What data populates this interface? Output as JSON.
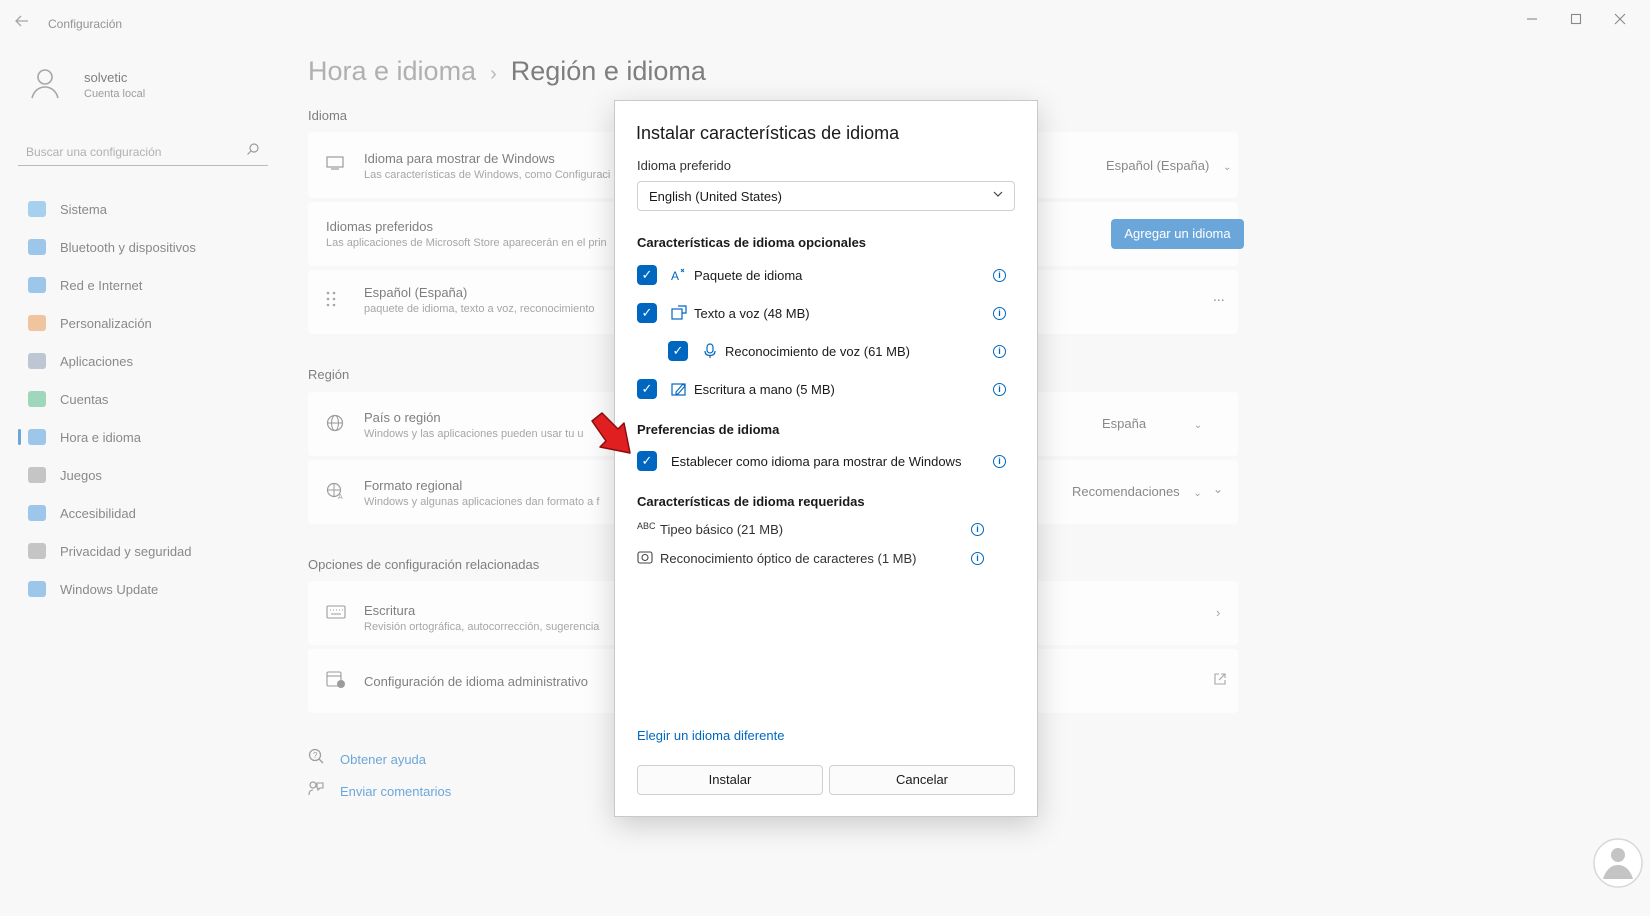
{
  "app": {
    "title": "Configuración",
    "back_icon": "back-arrow-icon",
    "window_controls": [
      "minimize-icon",
      "maximize-icon",
      "close-icon"
    ]
  },
  "user": {
    "name": "solvetic",
    "account_type": "Cuenta local"
  },
  "search": {
    "placeholder": "Buscar una configuración"
  },
  "sidebar": {
    "items": [
      {
        "label": "Sistema",
        "icon": "system-icon",
        "color": "#4aa3df"
      },
      {
        "label": "Bluetooth y dispositivos",
        "icon": "bluetooth-icon",
        "color": "#3b8fd6"
      },
      {
        "label": "Red e Internet",
        "icon": "wifi-icon",
        "color": "#3b8fd6"
      },
      {
        "label": "Personalización",
        "icon": "brush-icon",
        "color": "#e08a3c"
      },
      {
        "label": "Aplicaciones",
        "icon": "apps-icon",
        "color": "#7a8ea5"
      },
      {
        "label": "Cuentas",
        "icon": "person-icon",
        "color": "#3fb07a"
      },
      {
        "label": "Hora e idioma",
        "icon": "globe-clock-icon",
        "color": "#3b8fd6",
        "active": true
      },
      {
        "label": "Juegos",
        "icon": "gamepad-icon",
        "color": "#8c8c8c"
      },
      {
        "label": "Accesibilidad",
        "icon": "accessibility-icon",
        "color": "#3b8fd6"
      },
      {
        "label": "Privacidad y seguridad",
        "icon": "shield-icon",
        "color": "#8c8c8c"
      },
      {
        "label": "Windows Update",
        "icon": "update-icon",
        "color": "#3b8fd6"
      }
    ]
  },
  "breadcrumb": {
    "parent": "Hora e idioma",
    "separator": "›",
    "current": "Región e idioma"
  },
  "main": {
    "section_language": "Idioma",
    "display_language": {
      "title": "Idioma para mostrar de Windows",
      "desc": "Las características de Windows, como Configuraci",
      "value": "Español (España)"
    },
    "preferred_languages": {
      "title": "Idiomas preferidos",
      "desc": "Las aplicaciones de Microsoft Store aparecerán en el prin",
      "button": "Agregar un idioma"
    },
    "language_entry": {
      "title": "Español (España)",
      "desc": "paquete de idioma, texto a voz, reconocimiento",
      "more": "..."
    },
    "section_region": "Región",
    "country": {
      "title": "País o región",
      "desc": "Windows y las aplicaciones pueden usar tu u",
      "value": "España"
    },
    "regional_format": {
      "title": "Formato regional",
      "desc": "Windows y algunas aplicaciones dan formato a f",
      "value": "Recomendaciones"
    },
    "section_related": "Opciones de configuración relacionadas",
    "typing": {
      "title": "Escritura",
      "desc": "Revisión ortográfica, autocorrección, sugerencia"
    },
    "admin_lang": {
      "title": "Configuración de idioma administrativo"
    },
    "help_link": "Obtener ayuda",
    "feedback_link": "Enviar comentarios"
  },
  "dialog": {
    "title": "Instalar características de idioma",
    "preferred_label": "Idioma preferido",
    "preferred_value": "English (United States)",
    "optional_header": "Características de idioma opcionales",
    "optional": [
      {
        "label": "Paquete de idioma",
        "icon": "language-pack-icon",
        "checked": true
      },
      {
        "label": "Texto a voz (48 MB)",
        "icon": "text-to-speech-icon",
        "checked": true
      },
      {
        "label": "Reconocimiento de voz (61 MB)",
        "icon": "microphone-icon",
        "checked": true
      },
      {
        "label": "Escritura a mano (5 MB)",
        "icon": "handwriting-icon",
        "checked": true
      }
    ],
    "prefs_header": "Preferencias de idioma",
    "prefs": [
      {
        "label": "Establecer como idioma para mostrar de Windows",
        "checked": true
      }
    ],
    "required_header": "Características de idioma requeridas",
    "required": [
      {
        "label": "Tipeo básico (21 MB)",
        "icon": "abc-icon",
        "icon_text": "ABC"
      },
      {
        "label": "Reconocimiento óptico de caracteres (1 MB)",
        "icon": "camera-ocr-icon"
      }
    ],
    "choose_link": "Elegir un idioma diferente",
    "install_button": "Instalar",
    "cancel_button": "Cancelar"
  },
  "colors": {
    "accent": "#0067c0",
    "annotation_arrow": "#e02020"
  }
}
